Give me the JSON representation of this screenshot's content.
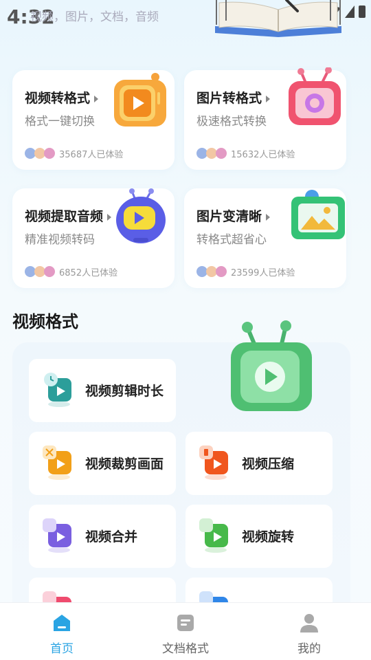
{
  "status_bar": {
    "time": "4:32",
    "notification_text": "视频，图片，文档，音频"
  },
  "feature_cards": [
    {
      "title": "视频转格式",
      "subtitle": "格式一键切换",
      "count": "35687人已体验",
      "icon": "orange-tv-play-icon"
    },
    {
      "title": "图片转格式",
      "subtitle": "极速格式转换",
      "count": "15632人已体验",
      "icon": "pink-tv-image-icon"
    },
    {
      "title": "视频提取音频",
      "subtitle": "精准视频转码",
      "count": "6852人已体验",
      "icon": "blue-robot-play-icon"
    },
    {
      "title": "图片变清晰",
      "subtitle": "转格式超省心",
      "count": "23599人已体验",
      "icon": "green-image-frame-icon"
    }
  ],
  "section": {
    "title": "视频格式"
  },
  "tools": [
    {
      "label": "视频剪辑时长",
      "icon": "clock-video-icon",
      "color": "#2c9e9a"
    },
    {
      "label": "视频裁剪画面",
      "icon": "scissors-video-icon",
      "color": "#f2a019"
    },
    {
      "label": "视频压缩",
      "icon": "compress-video-icon",
      "color": "#f0561e"
    },
    {
      "label": "视频合并",
      "icon": "merge-video-icon",
      "color": "#7a5fe0"
    },
    {
      "label": "视频旋转",
      "icon": "rotate-video-icon",
      "color": "#47b94a"
    },
    {
      "label": "",
      "icon": "audio-video-icon",
      "color": "#ef4b6e"
    },
    {
      "label": "",
      "icon": "text-video-icon",
      "color": "#2f86e8"
    }
  ],
  "bottom_nav": [
    {
      "label": "首页",
      "icon": "home-icon",
      "active": true
    },
    {
      "label": "文档格式",
      "icon": "document-icon",
      "active": false
    },
    {
      "label": "我的",
      "icon": "user-icon",
      "active": false
    }
  ],
  "colors": {
    "accent": "#2aa4e3",
    "inactive": "#666666"
  }
}
